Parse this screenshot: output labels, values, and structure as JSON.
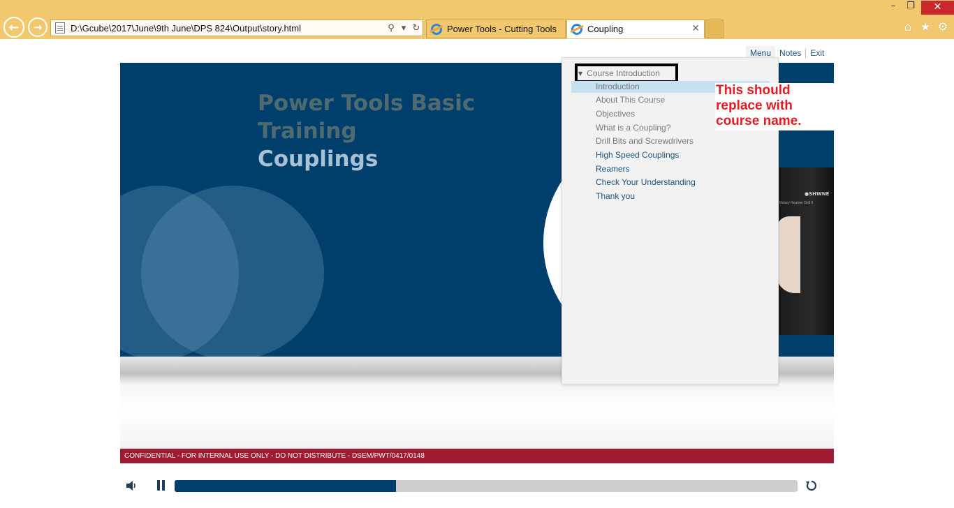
{
  "browser": {
    "address_url": "D:\\Gcube\\2017\\June\\9th June\\DPS 824\\Output\\story.html",
    "tabs": [
      {
        "label": "Power Tools - Cutting Tools",
        "active": false
      },
      {
        "label": "Coupling",
        "active": true
      }
    ],
    "icons": [
      "back-arrow-icon",
      "forward-arrow-icon",
      "search-icon",
      "refresh-icon",
      "home-icon",
      "star-icon",
      "gear-icon"
    ]
  },
  "player": {
    "links": {
      "menu": "Menu",
      "notes": "Notes",
      "exit": "Exit"
    },
    "progress_fraction": 0.355
  },
  "slide": {
    "title_line1": "Power Tools Basic",
    "title_line2": "Training",
    "title_line3": "Couplings",
    "tool_brand": "●SHWNE",
    "tool_caption": "Rotary Reamer Drill II"
  },
  "menu": {
    "section": "Course Introduction",
    "items": [
      {
        "label": "Introduction",
        "style": "gray",
        "active": true
      },
      {
        "label": "About This Course",
        "style": "gray"
      },
      {
        "label": "Objectives",
        "style": "gray"
      },
      {
        "label": "What is a Coupling?",
        "style": "gray"
      },
      {
        "label": "Drill Bits and Screwdrivers",
        "style": "gray"
      },
      {
        "label": "High Speed Couplings",
        "style": "blue"
      },
      {
        "label": "Reamers",
        "style": "blue"
      },
      {
        "label": "Check Your Understanding",
        "style": "blue"
      },
      {
        "label": "Thank you",
        "style": "blue"
      }
    ]
  },
  "annotation": {
    "line1": "This should",
    "line2": "replace with",
    "line3": "course name."
  },
  "footer": {
    "confidential": "CONFIDENTIAL - FOR INTERNAL USE ONLY - DO NOT DISTRIBUTE - DSEM/PWT/0417/0148"
  },
  "colors": {
    "chrome": "#f1c86e",
    "slide_blue": "#003f6b",
    "confidential_bar": "#9e1b32",
    "annotation_red": "#e31c24",
    "menu_active": "#c6e1f0"
  }
}
